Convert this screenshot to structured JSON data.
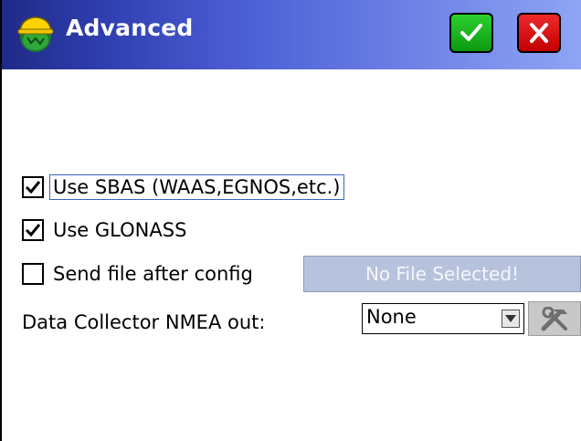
{
  "window": {
    "title": "Advanced",
    "app_icon": "surveyor-helmet-icon",
    "ok_icon": "checkmark-icon",
    "close_icon": "close-x-icon",
    "accent_color": "#2f3fb0"
  },
  "options": {
    "use_sbas": {
      "label": "Use SBAS (WAAS,EGNOS,etc.)",
      "checked": true
    },
    "use_glonass": {
      "label": "Use GLONASS",
      "checked": true
    },
    "send_file": {
      "label": "Send file after config",
      "checked": false
    }
  },
  "file_button": {
    "label": "No File Selected!"
  },
  "nmea": {
    "label": "Data Collector NMEA out:",
    "selected": "None",
    "tool_icon": "wrench-hammer-icon"
  }
}
